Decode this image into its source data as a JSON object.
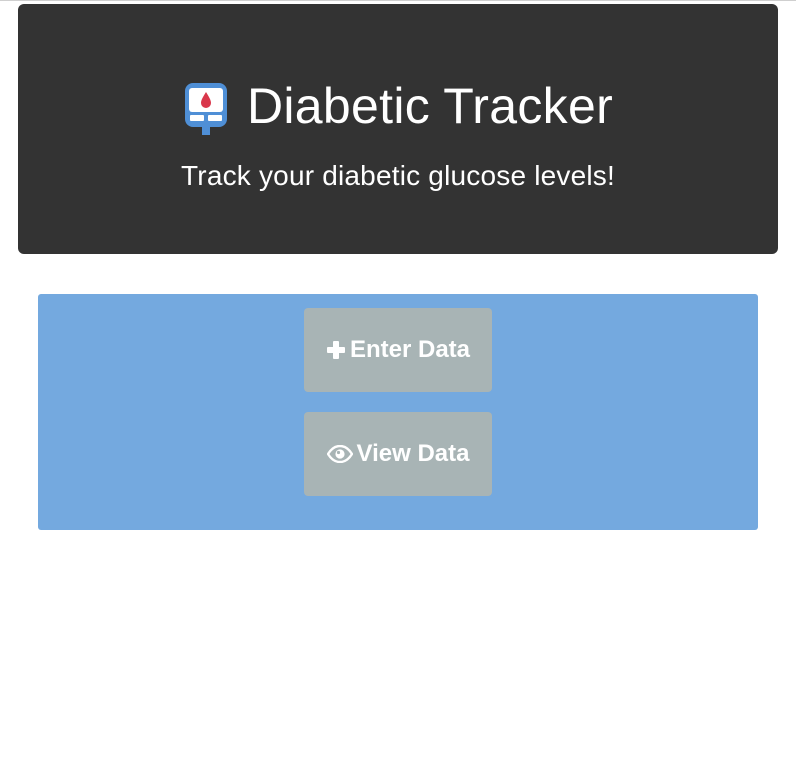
{
  "header": {
    "logo_icon": "glucose-meter-icon",
    "title": "Diabetic Tracker",
    "subtitle": "Track your diabetic glucose levels!",
    "background_color": "#333333"
  },
  "actions": {
    "panel_color": "#74a9df",
    "button_color": "#a8b4b5",
    "enter_data": {
      "icon": "plus-icon",
      "label": "Enter Data"
    },
    "view_data": {
      "icon": "eye-icon",
      "label": "View Data"
    }
  }
}
